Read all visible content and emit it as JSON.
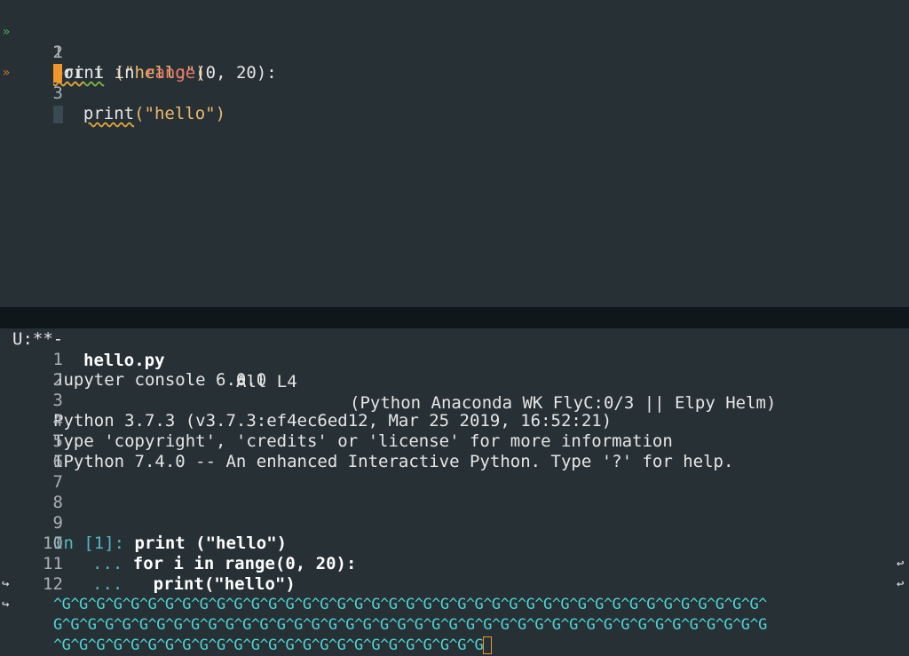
{
  "editor": {
    "lines": [
      {
        "num": "1",
        "fringe": "»",
        "code_a": "print",
        "code_b": " (\"hello\")"
      },
      {
        "num": "2",
        "fringe": "",
        "kw_for": "for",
        "var": " i ",
        "kw_in": "in",
        "sp": " ",
        "fn": "range",
        "args": "(0, 20):"
      },
      {
        "num": "3",
        "fringe": "»",
        "fn": "print",
        "args": "(\"hello\")"
      }
    ]
  },
  "modeline": {
    "status": "U:**-",
    "filename": "hello.py",
    "position": "All L4",
    "modes": "(Python Anaconda WK FlyC:0/3 || Elpy Helm)"
  },
  "console": {
    "lines": [
      {
        "num": "1",
        "text": "Jupyter console 6.0.0"
      },
      {
        "num": "2",
        "text": ""
      },
      {
        "num": "3",
        "text": "Python 3.7.3 (v3.7.3:ef4ec6ed12, Mar 25 2019, 16:52:21)"
      },
      {
        "num": "4",
        "text": "Type 'copyright', 'credits' or 'license' for more information"
      },
      {
        "num": "5",
        "text": "IPython 7.4.0 -- An enhanced Interactive Python. Type '?' for help."
      },
      {
        "num": "6",
        "text": ""
      },
      {
        "num": "7",
        "text": ""
      },
      {
        "num": "8",
        "text": ""
      }
    ],
    "in_prompt": "In [1]:",
    "in_code": " print (\"hello\")",
    "cont1_num": "10",
    "cont1_prompt": "...",
    "cont1_code": " for i in range(0, 20):",
    "cont2_num": "11",
    "cont2_prompt": "...",
    "cont2_code": "   print(\"hello\")",
    "ctl_num": "12",
    "ctl_line1": "^G^G^G^G^G^G^G^G^G^G^G^G^G^G^G^G^G^G^G^G^G^G^G^G^G^G^G^G^G^G^G^G^G^G^G^G^G^G^G^G^G^",
    "ctl_line2": "G^G^G^G^G^G^G^G^G^G^G^G^G^G^G^G^G^G^G^G^G^G^G^G^G^G^G^G^G^G^G^G^G^G^G^G^G^G^G^G^G^G",
    "ctl_line3": "^G^G^G^G^G^G^G^G^G^G^G^G^G^G^G^G^G^G^G^G^G^G^G^G^G"
  },
  "colors": {
    "background": "#263035",
    "modeline_bg": "#10171b",
    "cursor": "#f0962c",
    "prompt": "#56b6c2"
  }
}
